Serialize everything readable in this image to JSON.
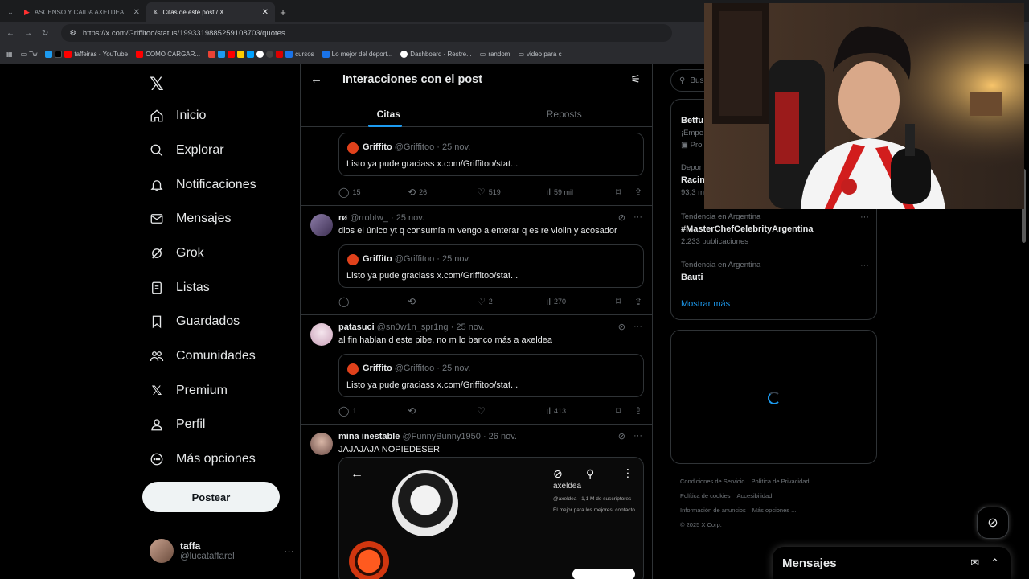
{
  "browser": {
    "tabs": [
      {
        "label": "ASCENSO Y CAIDA AXELDEA",
        "active": false
      },
      {
        "label": "Citas de este post / X",
        "active": true
      }
    ],
    "url": "https://x.com/Griffitoo/status/1993319885259108703/quotes",
    "bookmarks": [
      "Tw",
      "taffeiras - YouTube",
      "COMO CARGAR...",
      "cursos",
      "Lo mejor del deport...",
      "Dashboard - Restre...",
      "random",
      "video para c"
    ]
  },
  "nav": {
    "items": [
      "Inicio",
      "Explorar",
      "Notificaciones",
      "Mensajes",
      "Grok",
      "Listas",
      "Guardados",
      "Comunidades",
      "Premium",
      "Perfil",
      "Más opciones"
    ],
    "post_button": "Postear",
    "account": {
      "name": "taffa",
      "handle": "@lucataffarel"
    }
  },
  "main": {
    "title": "Interacciones con el post",
    "tabs": [
      "Citas",
      "Reposts"
    ],
    "quoted": {
      "name": "Griffito",
      "handle": "@Griffitoo",
      "date": "· 25 nov.",
      "text": "Listo ya pude graciass x.com/Griffitoo/stat..."
    },
    "posts": [
      {
        "name": "",
        "handle": "",
        "date": "",
        "text": "",
        "stats": {
          "replies": "15",
          "reposts": "26",
          "likes": "519",
          "views": "59 mil"
        }
      },
      {
        "name": "rø",
        "handle": "@rrobtw_",
        "date": "· 25 nov.",
        "text": "dios el único yt q consumía m vengo a enterar q es re violin y acosador",
        "stats": {
          "replies": "",
          "reposts": "",
          "likes": "2",
          "views": "270"
        }
      },
      {
        "name": "patasuci",
        "handle": "@sn0w1n_spr1ng",
        "date": "· 25 nov.",
        "text": "al fin hablan d este pibe, no m lo banco más a axeldea",
        "stats": {
          "replies": "1",
          "reposts": "",
          "likes": "",
          "views": "413"
        }
      },
      {
        "name": "mina inestable",
        "handle": "@FunnyBunny1950",
        "date": "· 26 nov.",
        "text": "JAJAJAJA NOPIEDESER"
      }
    ],
    "media": {
      "channel": "axeldea",
      "handle": "@axeldea",
      "subs": "1,1 M de suscriptores",
      "tagline": "El mejor para los mejores. contacto"
    }
  },
  "right": {
    "search_placeholder": "Bus",
    "partial": {
      "line1": "Betfu",
      "line2": "¡Empe",
      "line3": "Pro",
      "line4": "Depor",
      "line5": "Racin",
      "line6": "93,3 m"
    },
    "trends": [
      {
        "context": "Tendencia en Argentina",
        "name": "#MasterChefCelebrityArgentina",
        "count": "2.233 publicaciones"
      },
      {
        "context": "Tendencia en Argentina",
        "name": "Bauti",
        "count": ""
      }
    ],
    "show_more": "Mostrar más",
    "footer": [
      "Condiciones de Servicio",
      "Política de Privacidad",
      "Política de cookies",
      "Accesibilidad",
      "Información de anuncios",
      "Más opciones ...",
      "© 2025 X Corp."
    ]
  },
  "dock": {
    "title": "Mensajes"
  },
  "colors": {
    "accent": "#1d9bf0",
    "background": "#000000",
    "border": "#2f3336",
    "muted": "#71767b"
  }
}
